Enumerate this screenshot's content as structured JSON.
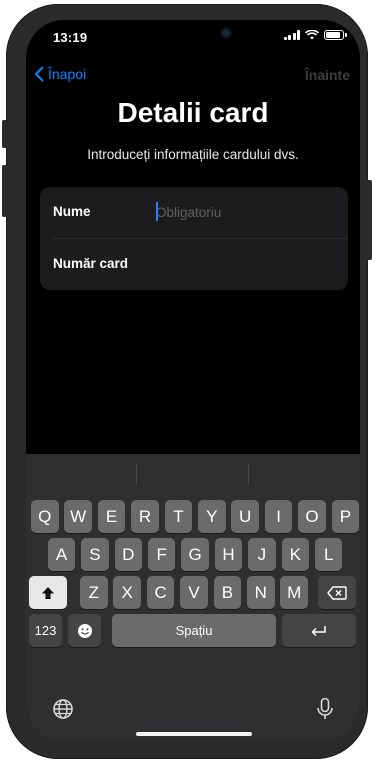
{
  "status_bar": {
    "time": "13:19"
  },
  "nav": {
    "back_label": "Înapoi",
    "forward_label": "Înainte"
  },
  "header": {
    "title": "Detalii card",
    "subtitle": "Introduceți informațiile cardului dvs."
  },
  "form": {
    "name_label": "Nume",
    "name_placeholder": "Obligatoriu",
    "name_value": "",
    "card_number_label": "Număr card",
    "card_number_value": ""
  },
  "keyboard": {
    "row1": [
      "Q",
      "W",
      "E",
      "R",
      "T",
      "Y",
      "U",
      "I",
      "O",
      "P"
    ],
    "row2": [
      "A",
      "S",
      "D",
      "F",
      "G",
      "H",
      "J",
      "K",
      "L"
    ],
    "row3": [
      "Z",
      "X",
      "C",
      "V",
      "B",
      "N",
      "M"
    ],
    "numbers_label": "123",
    "space_label": "Spațiu"
  },
  "colors": {
    "accent": "#0a84ff",
    "background": "#000000",
    "field_bg": "#1c1c1e",
    "key_bg": "#6b6b6e",
    "keyboard_bg": "#2f2f31"
  },
  "icons": {
    "back": "chevron-left-icon",
    "shift": "shift-arrow-icon",
    "delete": "backspace-icon",
    "emoji": "emoji-icon",
    "return": "return-icon",
    "globe": "globe-icon",
    "mic": "microphone-icon"
  }
}
